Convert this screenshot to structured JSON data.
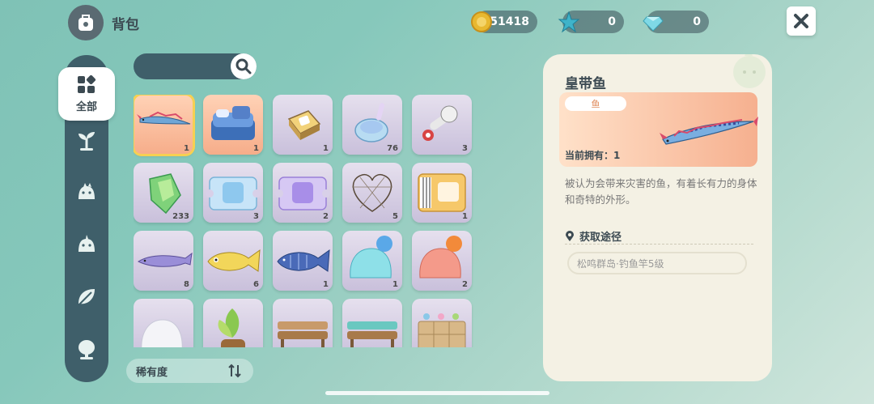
{
  "header": {
    "title": "背包",
    "bag_icon": "backpack-icon"
  },
  "currencies": [
    {
      "name": "coin",
      "icon": "gold-coin-icon",
      "value": "51418"
    },
    {
      "name": "star",
      "icon": "blue-star-icon",
      "value": "0"
    },
    {
      "name": "gem",
      "icon": "gem-icon",
      "value": "0"
    }
  ],
  "sidebar": {
    "active": {
      "label": "全部",
      "icon": "grid-all-icon"
    },
    "items": [
      {
        "icon": "sprout-icon"
      },
      {
        "icon": "creature-face-icon"
      },
      {
        "icon": "creature-face-icon"
      },
      {
        "icon": "leaf-icon"
      },
      {
        "icon": "tree-icon"
      }
    ]
  },
  "search": {
    "placeholder": "",
    "icon": "search-icon"
  },
  "items": [
    {
      "name": "oarfish",
      "count": "1",
      "bg": "orange",
      "selected": true
    },
    {
      "name": "blue-bed",
      "count": "1",
      "bg": "orange"
    },
    {
      "name": "cat-sign-box",
      "count": "1",
      "bg": "purple"
    },
    {
      "name": "blue-potion",
      "count": "76",
      "bg": "purple"
    },
    {
      "name": "mushroom-lamp",
      "count": "3",
      "bg": "purple"
    },
    {
      "name": "green-crystal",
      "count": "233",
      "bg": "purple"
    },
    {
      "name": "blue-ticket",
      "count": "3",
      "bg": "purple"
    },
    {
      "name": "purple-ticket",
      "count": "2",
      "bg": "purple"
    },
    {
      "name": "wire-heart",
      "count": "5",
      "bg": "purple"
    },
    {
      "name": "piano-ticket",
      "count": "1",
      "bg": "purple"
    },
    {
      "name": "purple-sturgeon",
      "count": "8",
      "bg": "purple"
    },
    {
      "name": "yellow-fish",
      "count": "6",
      "bg": "purple"
    },
    {
      "name": "blue-fish",
      "count": "1",
      "bg": "purple"
    },
    {
      "name": "blue-slime",
      "count": "1",
      "bg": "purple"
    },
    {
      "name": "red-slime",
      "count": "2",
      "bg": "purple"
    },
    {
      "name": "white-slime",
      "count": "",
      "bg": "purple"
    },
    {
      "name": "potted-plant",
      "count": "",
      "bg": "purple"
    },
    {
      "name": "wood-bench",
      "count": "",
      "bg": "purple"
    },
    {
      "name": "teal-bench",
      "count": "",
      "bg": "purple"
    },
    {
      "name": "shelf",
      "count": "",
      "bg": "purple"
    }
  ],
  "rarity": {
    "label": "稀有度",
    "icon": "sort-icon"
  },
  "detail": {
    "title": "皇带鱼",
    "type": "鱼",
    "owned": "当前拥有：1",
    "description": "被认为会带来灾害的鱼，有着长有力的身体和奇特的外形。",
    "source_title": "获取途径",
    "source_icon": "location-pin-icon",
    "source": "松鸣群岛·钓鱼竿5级"
  },
  "colors": {
    "accent": "#f6d052",
    "panel": "#f4f1e4",
    "dark": "#3f5f6a",
    "orange": "#f6ad8a"
  }
}
